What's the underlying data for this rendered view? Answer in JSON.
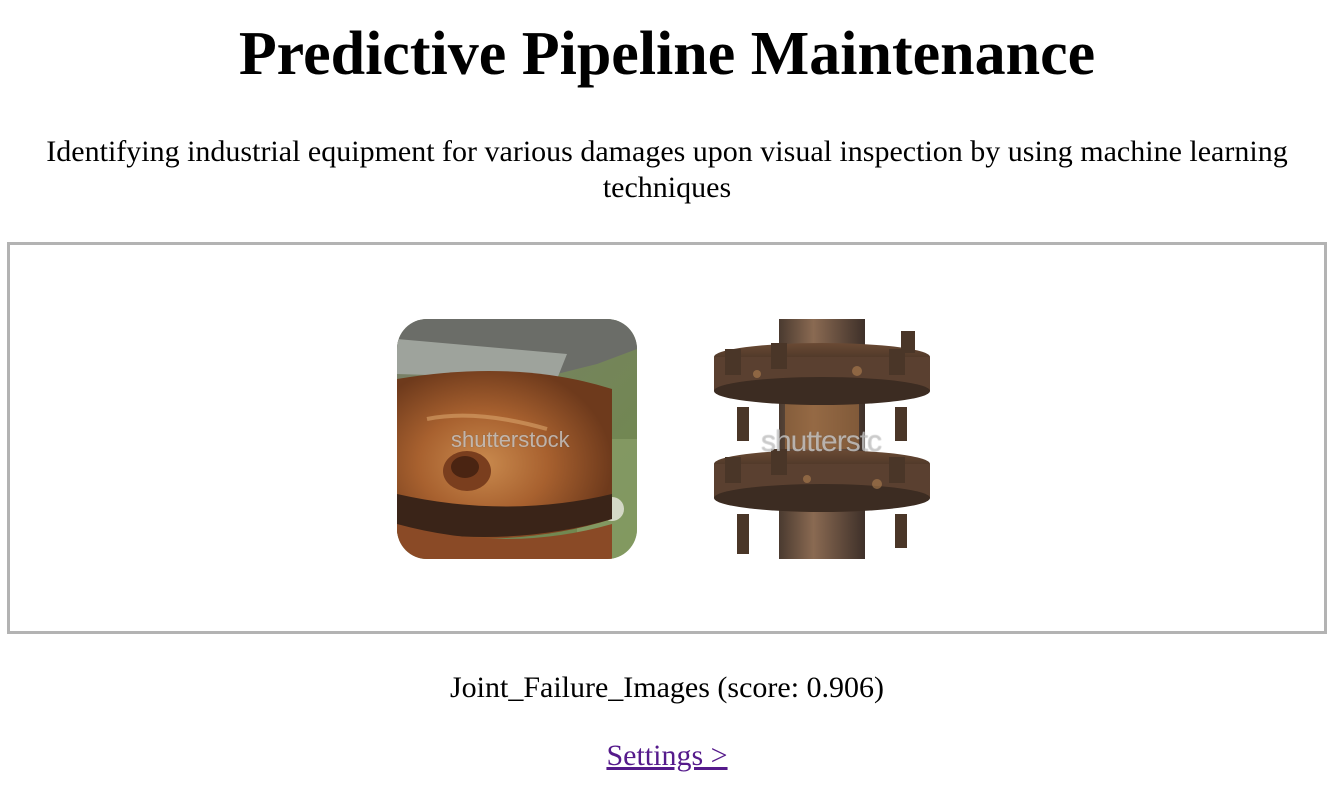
{
  "header": {
    "title": "Predictive Pipeline Maintenance",
    "subtitle": "Identifying industrial equipment for various damages upon visual inspection by using machine learning techniques"
  },
  "gallery": {
    "images": [
      {
        "name": "rusty-joint-closeup-image",
        "watermark": "shutterstock"
      },
      {
        "name": "rusty-flanged-pipe-image",
        "watermark": "shutterstc"
      }
    ]
  },
  "result": {
    "text": "Joint_Failure_Images (score: 0.906)"
  },
  "nav": {
    "settings_label": "Settings >"
  },
  "colors": {
    "border": "#b3b3b3",
    "link": "#551a8b",
    "rust": "#a85a2a"
  }
}
